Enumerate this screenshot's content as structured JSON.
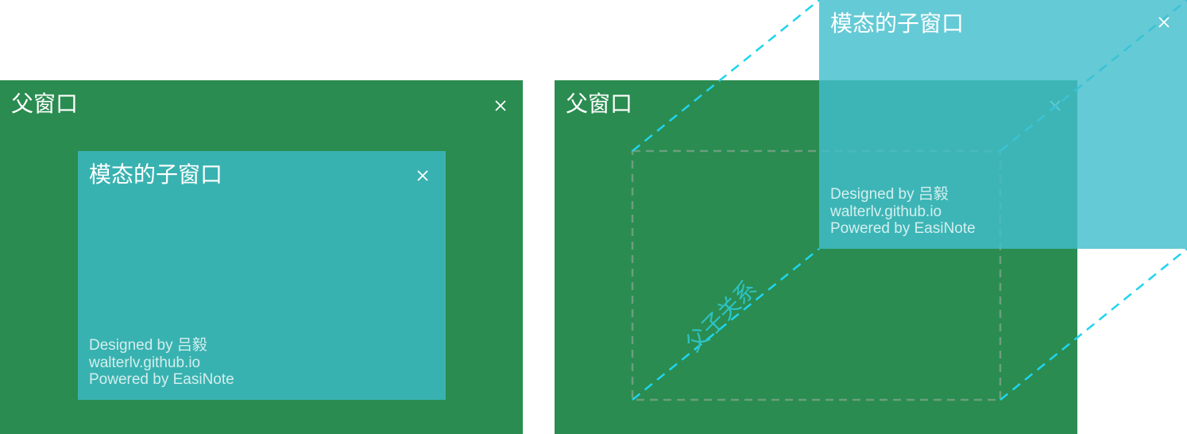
{
  "colors": {
    "parent_bg": "#2a8c50",
    "child_bg": "#38b2b0",
    "float_child_bg": "#5ec7d3",
    "dashed_line": "#1fd4f0",
    "dashed_box": "#6b9e7e",
    "relation_label": "#2ec2c4"
  },
  "left": {
    "parent": {
      "title": "父窗口",
      "close_icon": "close-icon"
    },
    "child": {
      "title": "模态的子窗口",
      "close_icon": "close-icon",
      "credits": [
        "Designed by 吕毅",
        "walterlv.github.io",
        "Powered by EasiNote"
      ]
    }
  },
  "right": {
    "parent": {
      "title": "父窗口",
      "close_icon": "close-icon"
    },
    "relation_label": "父子关系",
    "child": {
      "title": "模态的子窗口",
      "close_icon": "close-icon",
      "credits": [
        "Designed by 吕毅",
        "walterlv.github.io",
        "Powered by EasiNote"
      ]
    }
  }
}
